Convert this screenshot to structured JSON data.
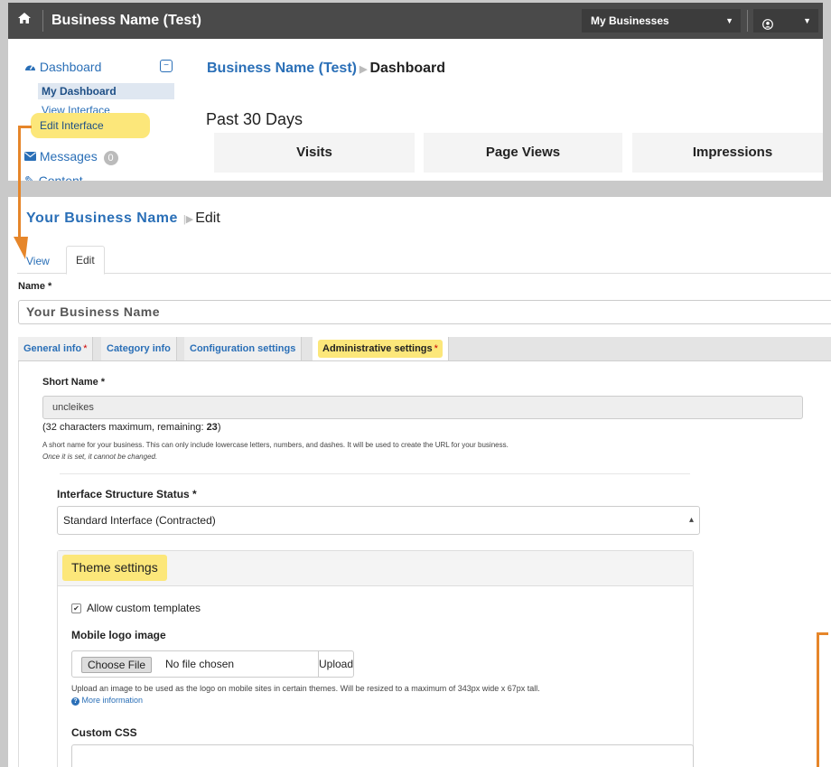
{
  "top_panel": {
    "navbar": {
      "home_icon": "home-icon",
      "brand": "Business Name (Test)",
      "businesses_dropdown": "My Businesses",
      "user_icon": "user-icon"
    },
    "sidebar": {
      "dashboard": "Dashboard",
      "collapse_icon": "minus-square-icon",
      "items": [
        {
          "label": "My Dashboard"
        },
        {
          "label": "View Interface"
        },
        {
          "label": "Edit Interface"
        }
      ],
      "messages": "Messages",
      "messages_count": "0",
      "content": "Content"
    },
    "breadcrumb": {
      "business": "Business Name (Test)",
      "current": "Dashboard"
    },
    "past_title": "Past 30 Days",
    "stats": [
      {
        "label": "Visits"
      },
      {
        "label": "Page Views"
      },
      {
        "label": "Impressions"
      }
    ]
  },
  "bottom_panel": {
    "breadcrumb": {
      "business": "Your Business Name",
      "current": "Edit"
    },
    "view_tabs": [
      {
        "label": "View"
      },
      {
        "label": "Edit"
      }
    ],
    "name_label": "Name *",
    "name_value": "Your Business Name",
    "form_tabs": [
      {
        "label": "General info",
        "required": "*"
      },
      {
        "label": "Category info",
        "required": ""
      },
      {
        "label": "Configuration settings",
        "required": ""
      },
      {
        "label": "Administrative settings",
        "required": "*"
      }
    ],
    "short_name_label": "Short Name *",
    "short_name_value": "uncleikes",
    "limit_prefix": "(32 characters maximum, remaining: ",
    "limit_remaining": "23",
    "limit_suffix": ")",
    "short_help": "A short name for your business. This can only include lowercase letters, numbers, and dashes. It will be used to create the URL for your business.",
    "short_help_note": "Once it is set, it cannot be changed.",
    "interface_label": "Interface Structure Status *",
    "interface_value": "Standard Interface (Contracted)",
    "theme_title": "Theme settings",
    "allow_templates": "Allow custom templates",
    "mobile_logo_label": "Mobile logo image",
    "choose_file": "Choose File",
    "no_file": "No file chosen",
    "upload": "Upload",
    "upload_help": "Upload an image to be used as the logo on mobile sites in certain themes. Will be resized to a maximum of 343px wide x 67px tall.",
    "more_info": "More information",
    "custom_css_label": "Custom CSS"
  },
  "colors": {
    "accent": "#2a6fb7",
    "highlight": "#fce77a",
    "arrow": "#e6862a",
    "navbar": "#4a4a4a"
  }
}
